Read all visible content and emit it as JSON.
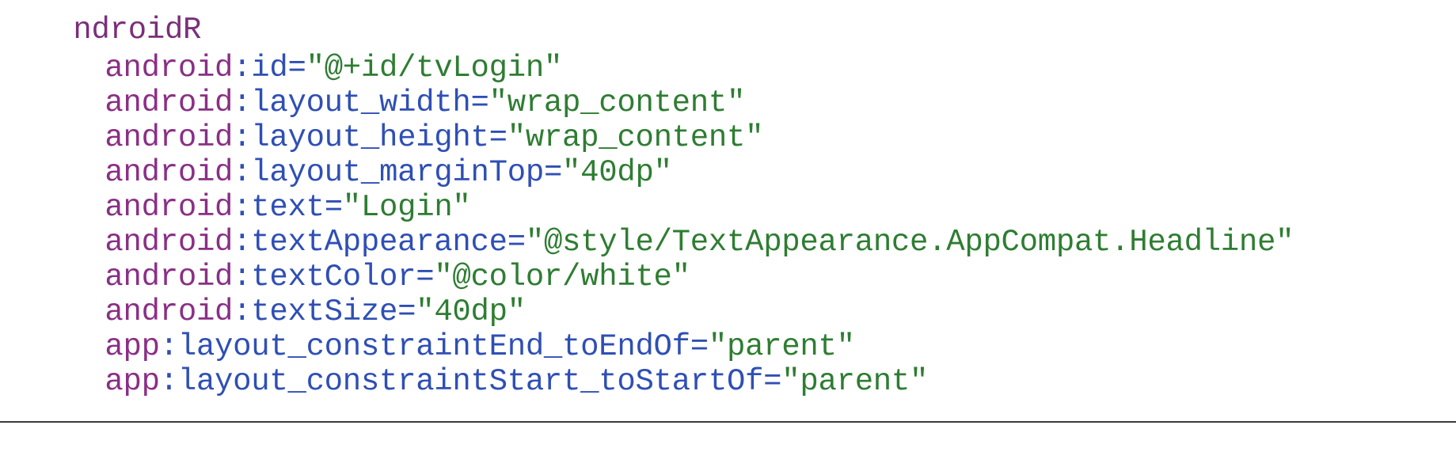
{
  "partial_top_line": "ndroidR",
  "lines": [
    {
      "ns": "android",
      "sep": ":",
      "attr": "id",
      "eq": "=",
      "value": "\"@+id/tvLogin\""
    },
    {
      "ns": "android",
      "sep": ":",
      "attr": "layout_width",
      "eq": "=",
      "value": "\"wrap_content\""
    },
    {
      "ns": "android",
      "sep": ":",
      "attr": "layout_height",
      "eq": "=",
      "value": "\"wrap_content\""
    },
    {
      "ns": "android",
      "sep": ":",
      "attr": "layout_marginTop",
      "eq": "=",
      "value": "\"40dp\""
    },
    {
      "ns": "android",
      "sep": ":",
      "attr": "text",
      "eq": "=",
      "value": "\"Login\""
    },
    {
      "ns": "android",
      "sep": ":",
      "attr": "textAppearance",
      "eq": "=",
      "value": "\"@style/TextAppearance.AppCompat.Headline\""
    },
    {
      "ns": "android",
      "sep": ":",
      "attr": "textColor",
      "eq": "=",
      "value": "\"@color/white\""
    },
    {
      "ns": "android",
      "sep": ":",
      "attr": "textSize",
      "eq": "=",
      "value": "\"40dp\""
    },
    {
      "ns": "app",
      "sep": ":",
      "attr": "layout_constraintEnd_toEndOf",
      "eq": "=",
      "value": "\"parent\""
    },
    {
      "ns": "app",
      "sep": ":",
      "attr": "layout_constraintStart_toStartOf",
      "eq": "=",
      "value": "\"parent\""
    }
  ],
  "colors": {
    "namespace": "#8a2f86",
    "attribute": "#2f4fb5",
    "value": "#2e7d32",
    "background": "#ffffff",
    "rule": "#3a3a3a"
  }
}
